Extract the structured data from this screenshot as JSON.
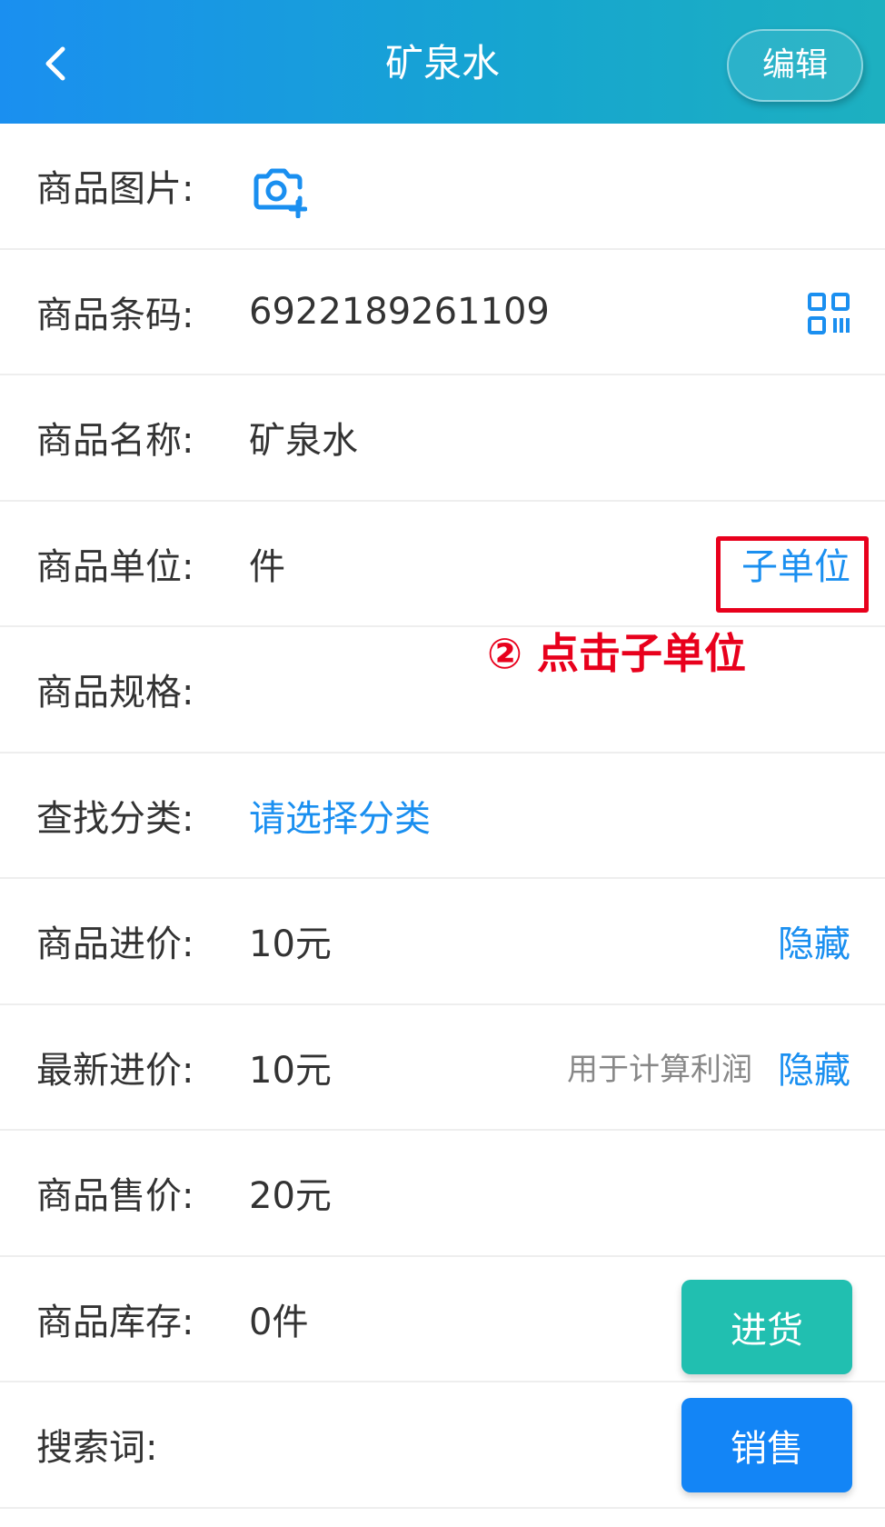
{
  "header": {
    "title": "矿泉水",
    "edit_label": "编辑"
  },
  "rows": [
    {
      "label": "商品图片:"
    },
    {
      "label": "商品条码:",
      "value": "6922189261109"
    },
    {
      "label": "商品名称:",
      "value": "矿泉水"
    },
    {
      "label": "商品单位:",
      "value": "件",
      "link": "子单位"
    },
    {
      "label": "商品规格:",
      "value": ""
    },
    {
      "label": "查找分类:",
      "value": "请选择分类"
    },
    {
      "label": "商品进价:",
      "value": "10元",
      "link": "隐藏"
    },
    {
      "label": "最新进价:",
      "value": "10元",
      "hint": "用于计算利润",
      "link": "隐藏"
    },
    {
      "label": "商品售价:",
      "value": "20元"
    },
    {
      "label": "商品库存:",
      "value": "0件"
    },
    {
      "label": "搜索词:",
      "value": ""
    }
  ],
  "annotation": "② 点击子单位",
  "buttons": {
    "stock_in": "进货",
    "sell": "销售"
  },
  "colors": {
    "accent": "#1a8ff0",
    "annotation_red": "#e8001c",
    "stock_btn": "#21bfb0",
    "sell_btn": "#1385f6"
  },
  "icons": {
    "back": "chevron-left-icon",
    "camera": "camera-add-icon",
    "scan": "qr-scan-icon"
  }
}
